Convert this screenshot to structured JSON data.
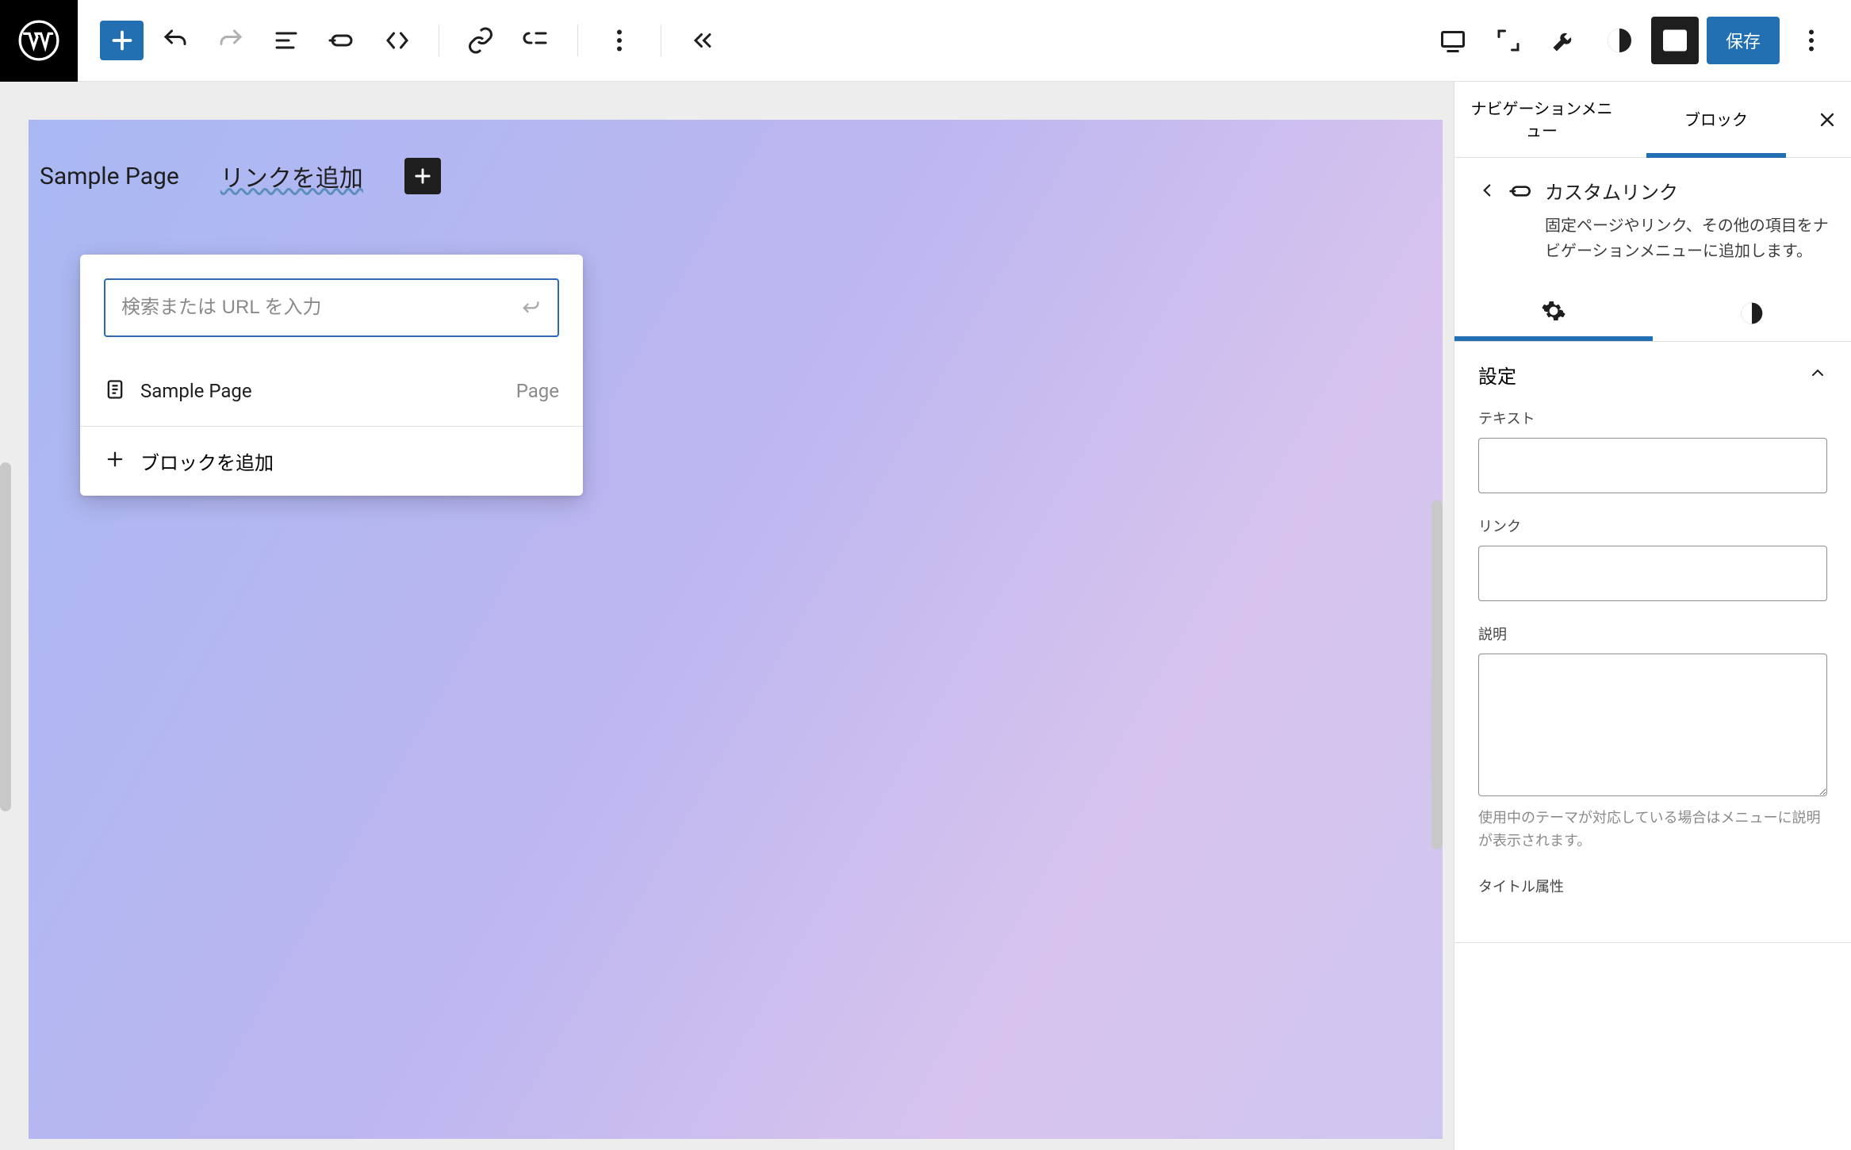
{
  "topbar": {
    "save_label": "保存"
  },
  "canvas": {
    "nav_item_1": "Sample Page",
    "add_link_label": "リンクを追加"
  },
  "link_popover": {
    "search_placeholder": "検索または URL を入力",
    "suggestion": {
      "title": "Sample Page",
      "type": "Page"
    },
    "add_block_label": "ブロックを追加"
  },
  "sidebar": {
    "tabs": {
      "nav_menu": "ナビゲーションメニュー",
      "block": "ブロック"
    },
    "block_header": {
      "title": "カスタムリンク",
      "desc": "固定ページやリンク、その他の項目をナビゲーションメニューに追加します。"
    },
    "settings_panel": {
      "title": "設定",
      "fields": {
        "text_label": "テキスト",
        "link_label": "リンク",
        "desc_label": "説明",
        "desc_help": "使用中のテーマが対応している場合はメニューに説明が表示されます。",
        "title_attr_label": "タイトル属性"
      }
    }
  }
}
